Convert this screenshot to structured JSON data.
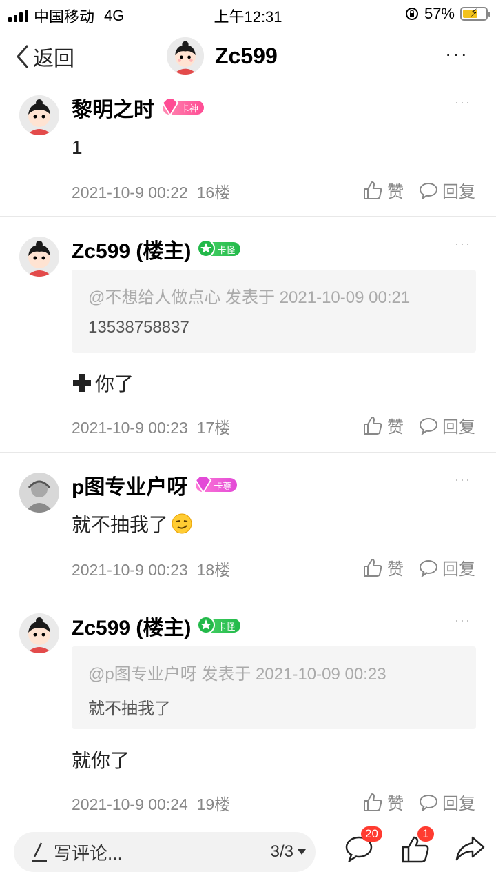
{
  "status_bar": {
    "carrier": "中国移动",
    "network": "4G",
    "time": "上午12:31",
    "battery": "57%"
  },
  "nav": {
    "back_label": "返回",
    "title": "Zc599",
    "more": "···"
  },
  "posts": [
    {
      "username": "黎明之时",
      "badge": "卡神",
      "content": "1",
      "timestamp": "2021-10-9 00:22",
      "floor": "16楼",
      "like": "赞",
      "reply": "回复"
    },
    {
      "username": "Zc599 (楼主)",
      "badge": "卡怪",
      "quote_header": "@不想给人做点心 发表于 2021-10-09 00:21",
      "quote_text": "13538758837",
      "content": "你了",
      "timestamp": "2021-10-9 00:23",
      "floor": "17楼",
      "like": "赞",
      "reply": "回复"
    },
    {
      "username": "p图专业户呀",
      "badge": "卡尊",
      "content": "就不抽我了",
      "timestamp": "2021-10-9 00:23",
      "floor": "18楼",
      "like": "赞",
      "reply": "回复"
    },
    {
      "username": "Zc599 (楼主)",
      "badge": "卡怪",
      "quote_header": "@p图专业户呀 发表于 2021-10-09 00:23",
      "quote_text": "就不抽我了",
      "content": "就你了",
      "timestamp": "2021-10-9 00:24",
      "floor": "19楼",
      "like": "赞",
      "reply": "回复"
    }
  ],
  "bottom_bar": {
    "placeholder": "写评论...",
    "page": "3/3",
    "comments_count": "20",
    "likes_count": "1"
  },
  "colors": {
    "badge_pink": "#ff4c94",
    "badge_green": "#23b94a",
    "badge_magenta": "#e34ad7",
    "notification": "#ff3b30"
  }
}
